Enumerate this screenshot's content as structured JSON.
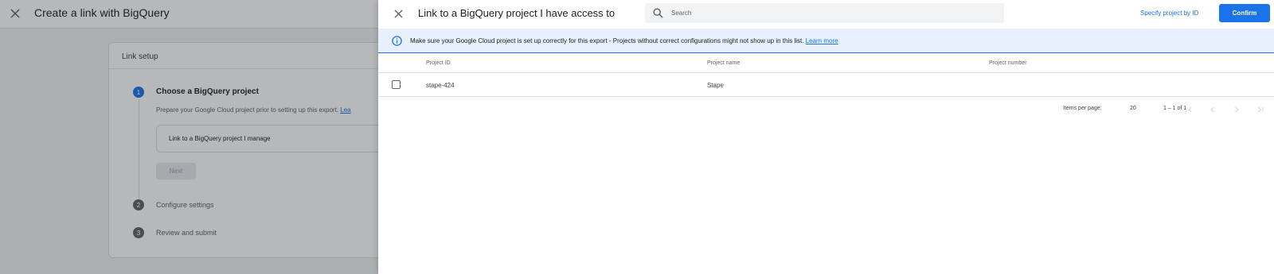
{
  "background_page": {
    "title": "Create a link with BigQuery",
    "card": {
      "title": "Link setup",
      "steps": [
        {
          "number": "1",
          "label": "Choose a BigQuery project",
          "state": "active"
        },
        {
          "number": "2",
          "label": "Configure settings",
          "state": "inactive"
        },
        {
          "number": "3",
          "label": "Review and submit",
          "state": "inactive"
        }
      ],
      "step_description": "Prepare your Google Cloud project prior to setting up this export.",
      "step_description_link": "Lea",
      "option_label": "Link to a BigQuery project I manage",
      "next_label": "Next"
    }
  },
  "panel": {
    "title": "Link to a BigQuery project I have access to",
    "search": {
      "placeholder": "Search",
      "value": ""
    },
    "specify_link": "Specify project by ID",
    "confirm_label": "Confirm"
  },
  "banner": {
    "text": "Make sure your Google Cloud project is set up correctly for this export - Projects without correct configurations might not show up in this list.",
    "link": "Learn more"
  },
  "table": {
    "columns": [
      "Project ID",
      "Project name",
      "Project number"
    ],
    "rows": [
      {
        "project_id": "stape-424",
        "project_name": "Stape",
        "project_number": "",
        "checked": false
      }
    ]
  },
  "paginator": {
    "items_per_page_label": "Items per page:",
    "items_per_page_value": "20",
    "range_label": "1 – 1 of 1"
  },
  "colors": {
    "accent": "#1a73e8",
    "banner_bg": "#e8f0fe",
    "scrim": "rgba(32,33,36,0.32)"
  },
  "icons": [
    "close-icon",
    "search-icon",
    "info-icon",
    "first-page-icon",
    "chevron-left-icon",
    "chevron-right-icon",
    "last-page-icon"
  ]
}
